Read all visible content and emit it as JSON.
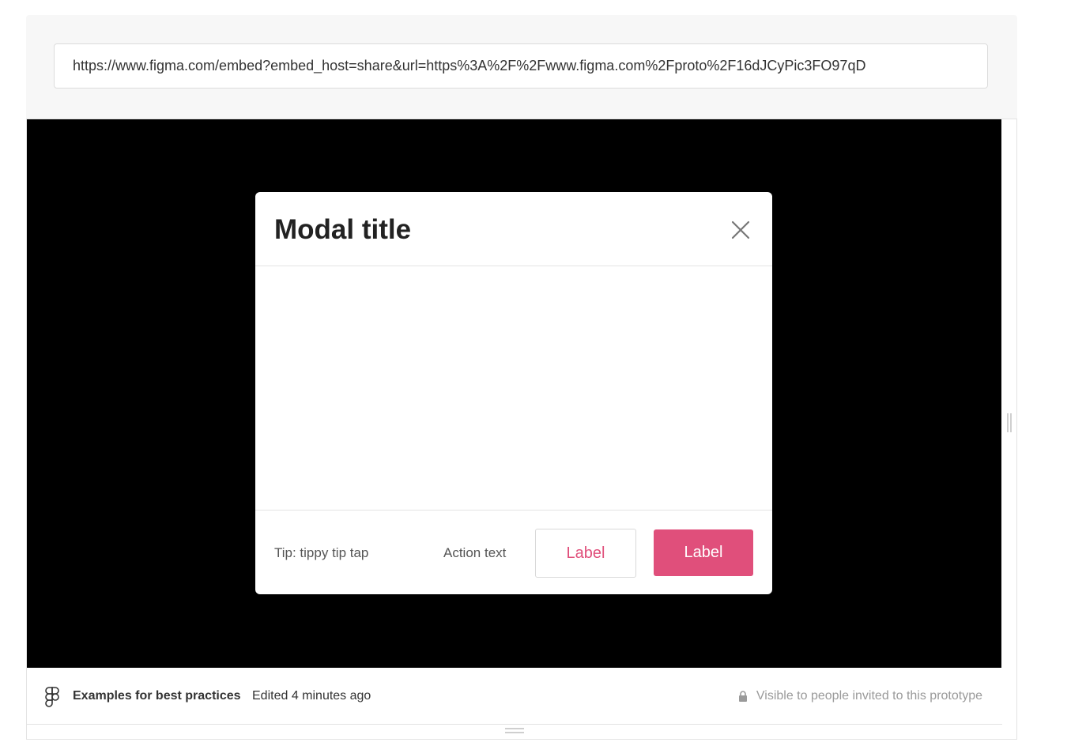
{
  "url_bar": {
    "value": "https://www.figma.com/embed?embed_host=share&url=https%3A%2F%2Fwww.figma.com%2Fproto%2F16dJCyPic3FO97qD"
  },
  "modal": {
    "title": "Modal title",
    "close_icon": "close-icon",
    "footer": {
      "tip": "Tip: tippy tip tap",
      "action_text": "Action text",
      "secondary_label": "Label",
      "primary_label": "Label"
    }
  },
  "footer": {
    "logo_icon": "figma-logo-icon",
    "file_name": "Examples for best practices",
    "edited": "Edited 4 minutes ago",
    "lock_icon": "lock-icon",
    "visibility": "Visible to people invited to this prototype"
  },
  "colors": {
    "accent": "#e04f7b",
    "canvas": "#000000",
    "panel": "#f7f7f7"
  }
}
